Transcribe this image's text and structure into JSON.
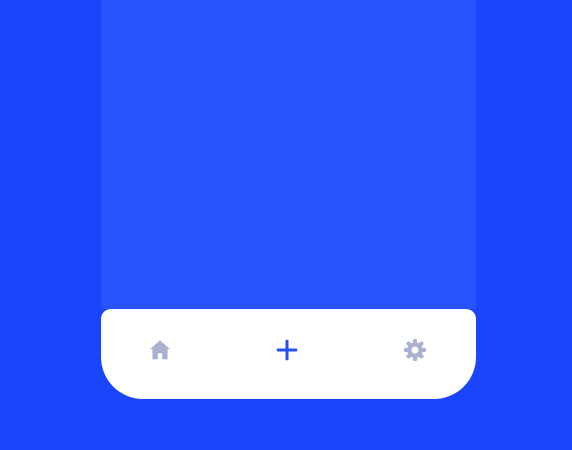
{
  "colors": {
    "background": "#1a45fb",
    "phone_screen": "#2752fc",
    "tab_bar": "#ffffff",
    "icon_inactive": "#aab1d1",
    "icon_active": "#2a4ff0"
  },
  "tab_bar": {
    "tabs": [
      {
        "icon": "home-icon",
        "active": false
      },
      {
        "icon": "plus-icon",
        "active": true
      },
      {
        "icon": "gear-icon",
        "active": false
      }
    ]
  }
}
